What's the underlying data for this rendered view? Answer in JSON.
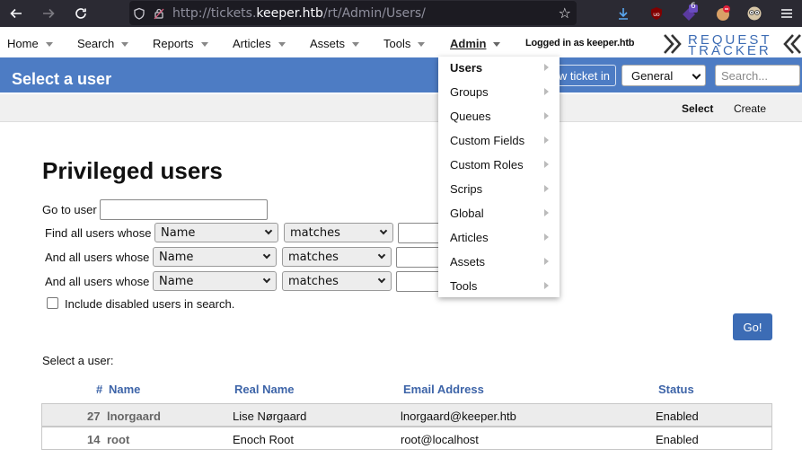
{
  "browser": {
    "url_prefix": "http://tickets.",
    "url_host": "keeper.htb",
    "url_path": "/rt/Admin/Users/",
    "extension_badge": "6"
  },
  "menu": {
    "items": [
      {
        "label": "Home"
      },
      {
        "label": "Search"
      },
      {
        "label": "Reports"
      },
      {
        "label": "Articles"
      },
      {
        "label": "Assets"
      },
      {
        "label": "Tools"
      },
      {
        "label": "Admin"
      }
    ],
    "logged_in": "Logged in as keeper.htb",
    "logo_line1": "REQUEST",
    "logo_line2": "TRACKER"
  },
  "header": {
    "title": "Select a user",
    "new_ticket_label": "w ticket in",
    "queue_value": "General",
    "search_placeholder": "Search..."
  },
  "subnav": {
    "select_label": "Select",
    "create_label": "Create"
  },
  "main": {
    "heading": "Privileged users",
    "go_to_user_label": "Go to user",
    "filters": [
      {
        "label": "Find all users whose",
        "field": "Name",
        "op": "matches"
      },
      {
        "label": "And all users whose",
        "field": "Name",
        "op": "matches"
      },
      {
        "label": "And all users whose",
        "field": "Name",
        "op": "matches"
      }
    ],
    "include_disabled_label": "Include disabled users in search.",
    "go_label": "Go!",
    "select_user_label": "Select a user:"
  },
  "table": {
    "headers": {
      "num": "#",
      "name": "Name",
      "real_name": "Real Name",
      "email": "Email Address",
      "status": "Status"
    },
    "rows": [
      {
        "num": "27",
        "name": "lnorgaard",
        "real_name": "Lise Nørgaard",
        "email": "lnorgaard@keeper.htb",
        "status": "Enabled"
      },
      {
        "num": "14",
        "name": "root",
        "real_name": "Enoch Root",
        "email": "root@localhost",
        "status": "Enabled"
      }
    ]
  },
  "admin_menu": {
    "items": [
      {
        "label": "Users"
      },
      {
        "label": "Groups"
      },
      {
        "label": "Queues"
      },
      {
        "label": "Custom Fields"
      },
      {
        "label": "Custom Roles"
      },
      {
        "label": "Scrips"
      },
      {
        "label": "Global"
      },
      {
        "label": "Articles"
      },
      {
        "label": "Assets"
      },
      {
        "label": "Tools"
      }
    ]
  },
  "colors": {
    "header_blue": "#4d7cc4",
    "link_blue": "#3d64a8",
    "button_blue": "#3c6cb5",
    "browser_chrome": "#2b2a33"
  }
}
